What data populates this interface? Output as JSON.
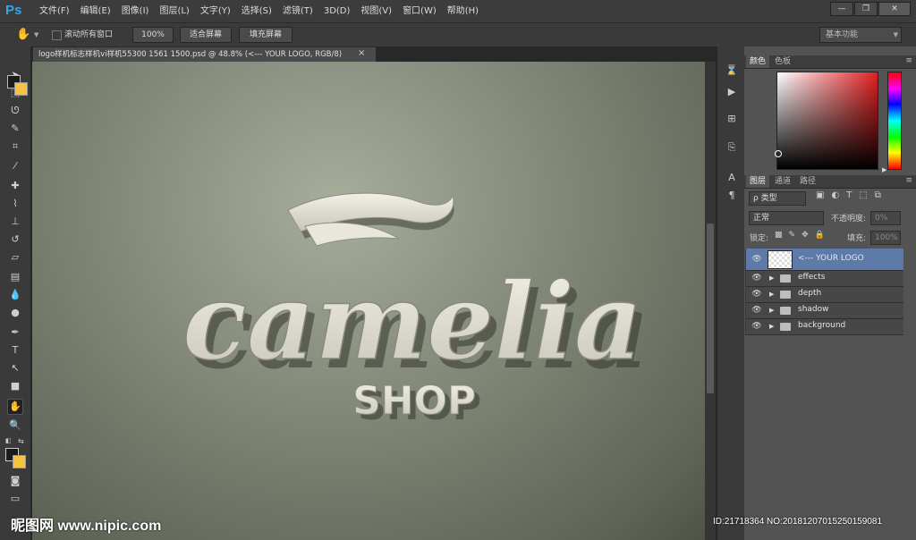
{
  "app": {
    "logo": "Ps"
  },
  "menu": [
    "文件(F)",
    "编辑(E)",
    "图像(I)",
    "图层(L)",
    "文字(Y)",
    "选择(S)",
    "滤镜(T)",
    "3D(D)",
    "视图(V)",
    "窗口(W)",
    "帮助(H)"
  ],
  "window_controls": {
    "minimize": "—",
    "restore": "❐",
    "close": "✕"
  },
  "options_bar": {
    "scroll_all_label": "滚动所有窗口",
    "zoom_100": "100%",
    "fit_screen": "适合屏幕",
    "fill_screen": "填充屏幕",
    "workspace": "基本功能"
  },
  "document_tab": {
    "title": "logo样机标志样机vi样机55300 1561 1500.psd @ 48.8% (<--- YOUR LOGO, RGB/8)",
    "close": "×"
  },
  "canvas": {
    "logo_script": "camelia",
    "logo_sub": "SHOP"
  },
  "color_panel": {
    "tabs": [
      "颜色",
      "色板"
    ],
    "foreground": "#1c1c1c",
    "background": "#f5c242"
  },
  "layers_panel": {
    "tabs": [
      "图层",
      "通道",
      "路径"
    ],
    "filter_kind": "ρ 类型",
    "blend_mode": "正常",
    "opacity_label": "不透明度:",
    "opacity_value": "0%",
    "lock_label": "锁定:",
    "fill_label": "填充:",
    "fill_value": "100%",
    "layers": [
      {
        "name": "<--- YOUR LOGO",
        "type": "smart-object",
        "selected": true
      },
      {
        "name": "effects",
        "type": "group"
      },
      {
        "name": "depth",
        "type": "group"
      },
      {
        "name": "shadow",
        "type": "group"
      },
      {
        "name": "background",
        "type": "group"
      }
    ]
  },
  "watermark": {
    "left": "昵图网 www.nipic.com",
    "right": "ID:21718364 NO:20181207015250159081"
  }
}
